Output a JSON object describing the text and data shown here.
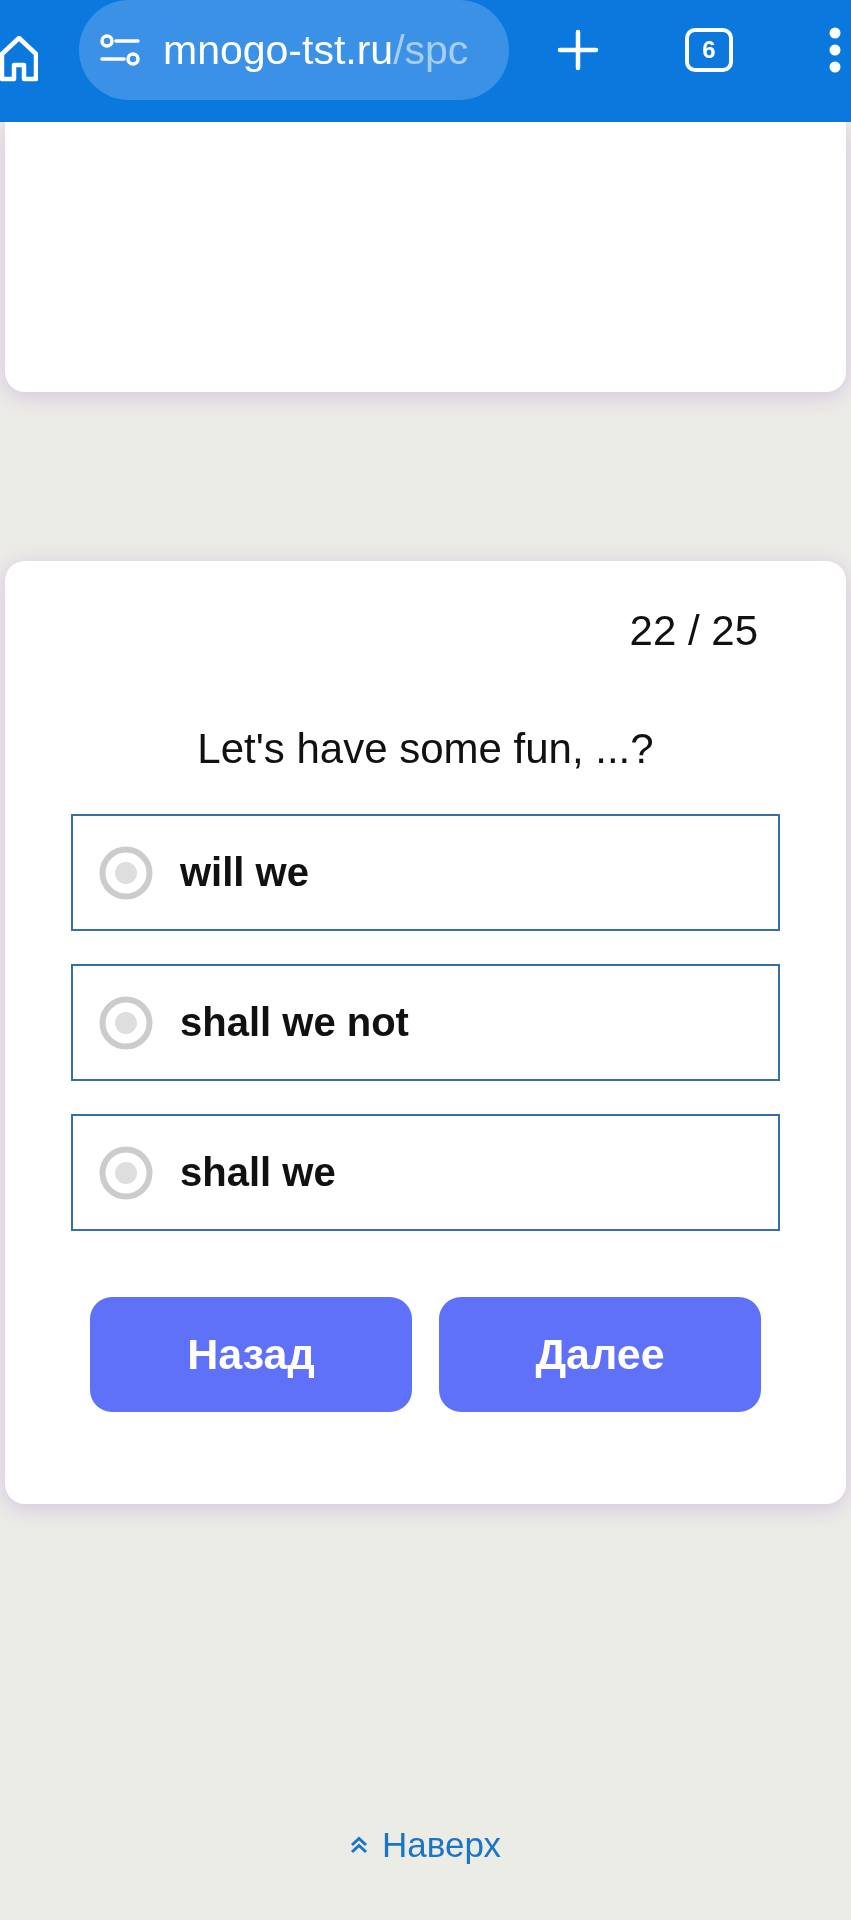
{
  "browser_bar": {
    "url_host": "mnogo-tst.ru",
    "url_path": "/spc",
    "tab_count": "6"
  },
  "quiz": {
    "progress": "22 / 25",
    "question": "Let's have some fun, ...?",
    "options": [
      {
        "label": "will we",
        "selected": false
      },
      {
        "label": "shall we not",
        "selected": false
      },
      {
        "label": "shall we",
        "selected": false
      }
    ],
    "buttons": [
      "Назад",
      "Далее"
    ]
  },
  "footer": {
    "link": "Наверх"
  }
}
